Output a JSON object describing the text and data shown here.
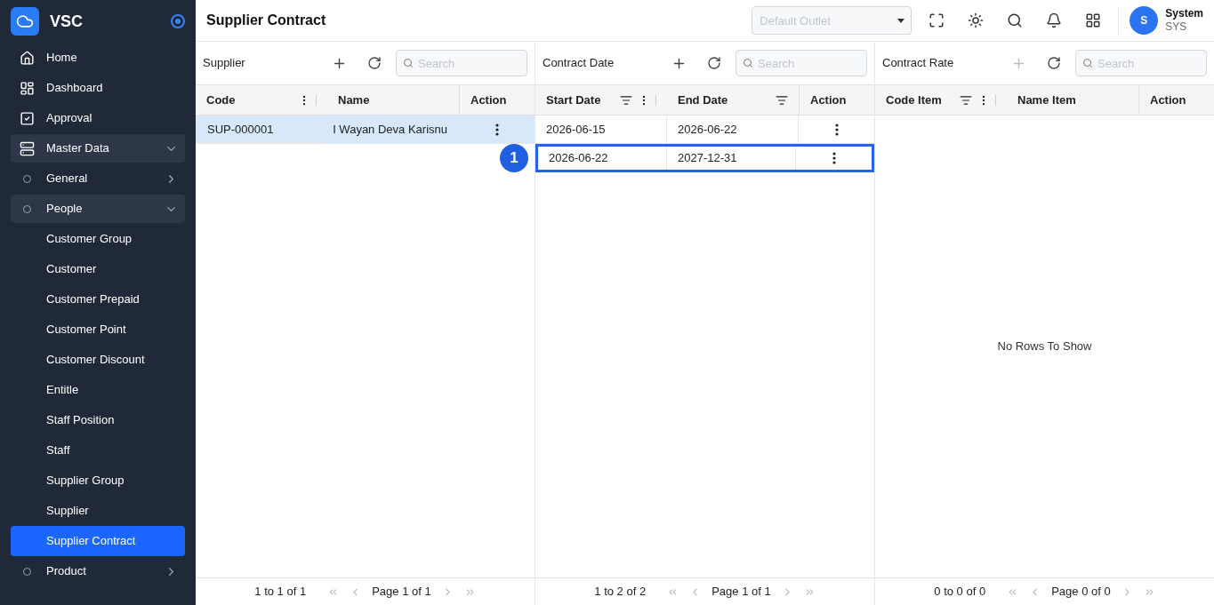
{
  "brand": {
    "name": "VSC"
  },
  "sidebar": {
    "items": [
      {
        "label": "Home",
        "kind": "link",
        "selected": false
      },
      {
        "label": "Dashboard",
        "kind": "link",
        "selected": false
      },
      {
        "label": "Approval",
        "kind": "link",
        "selected": false
      },
      {
        "label": "Master Data",
        "kind": "group",
        "expanded": true,
        "children": [
          {
            "label": "General",
            "kind": "group",
            "expanded": false
          },
          {
            "label": "People",
            "kind": "group",
            "expanded": true,
            "children": [
              {
                "label": "Customer Group",
                "kind": "link",
                "selected": false
              },
              {
                "label": "Customer",
                "kind": "link",
                "selected": false
              },
              {
                "label": "Customer Prepaid",
                "kind": "link",
                "selected": false
              },
              {
                "label": "Customer Point",
                "kind": "link",
                "selected": false
              },
              {
                "label": "Customer Discount",
                "kind": "link",
                "selected": false
              },
              {
                "label": "Entitle",
                "kind": "link",
                "selected": false
              },
              {
                "label": "Staff Position",
                "kind": "link",
                "selected": false
              },
              {
                "label": "Staff",
                "kind": "link",
                "selected": false
              },
              {
                "label": "Supplier Group",
                "kind": "link",
                "selected": false
              },
              {
                "label": "Supplier",
                "kind": "link",
                "selected": false
              },
              {
                "label": "Supplier Contract",
                "kind": "link",
                "selected": true
              }
            ]
          },
          {
            "label": "Product",
            "kind": "group",
            "expanded": false
          }
        ]
      }
    ]
  },
  "header": {
    "title": "Supplier Contract",
    "outlet": {
      "placeholder": "Default Outlet"
    },
    "user": {
      "initial": "S",
      "name": "System",
      "code": "SYS"
    }
  },
  "panels": [
    {
      "title": "Supplier",
      "add_disabled": false,
      "search": {
        "placeholder": "Search"
      },
      "columns": [
        {
          "label": "Code",
          "filter": false,
          "menu": true
        },
        {
          "label": "Name",
          "filter": false,
          "menu": false
        },
        {
          "label": "Action",
          "filter": false,
          "menu": false
        }
      ],
      "rows": [
        {
          "cells": [
            "SUP-000001",
            "I Wayan Deva Karisnu"
          ],
          "selected": true,
          "highlighted": false
        }
      ],
      "footer": {
        "range": "1 to 1 of 1",
        "page": "Page 1 of 1"
      }
    },
    {
      "title": "Contract Date",
      "add_disabled": false,
      "search": {
        "placeholder": "Search"
      },
      "columns": [
        {
          "label": "Start Date",
          "filter": true,
          "menu": true
        },
        {
          "label": "End Date",
          "filter": true,
          "menu": false
        },
        {
          "label": "Action",
          "filter": false,
          "menu": false
        }
      ],
      "rows": [
        {
          "cells": [
            "2026-06-15",
            "2026-06-22"
          ],
          "selected": false,
          "highlighted": false
        },
        {
          "cells": [
            "2026-06-22",
            "2027-12-31"
          ],
          "selected": false,
          "highlighted": true,
          "annotation": "1"
        }
      ],
      "footer": {
        "range": "1 to 2 of 2",
        "page": "Page 1 of 1"
      }
    },
    {
      "title": "Contract Rate",
      "add_disabled": true,
      "search": {
        "placeholder": "Search"
      },
      "columns": [
        {
          "label": "Code Item",
          "filter": true,
          "menu": true
        },
        {
          "label": "Name Item",
          "filter": false,
          "menu": false
        },
        {
          "label": "Action",
          "filter": false,
          "menu": false
        }
      ],
      "empty_text": "No Rows To Show",
      "footer": {
        "range": "0 to 0 of 0",
        "page": "Page 0 of 0"
      }
    }
  ]
}
